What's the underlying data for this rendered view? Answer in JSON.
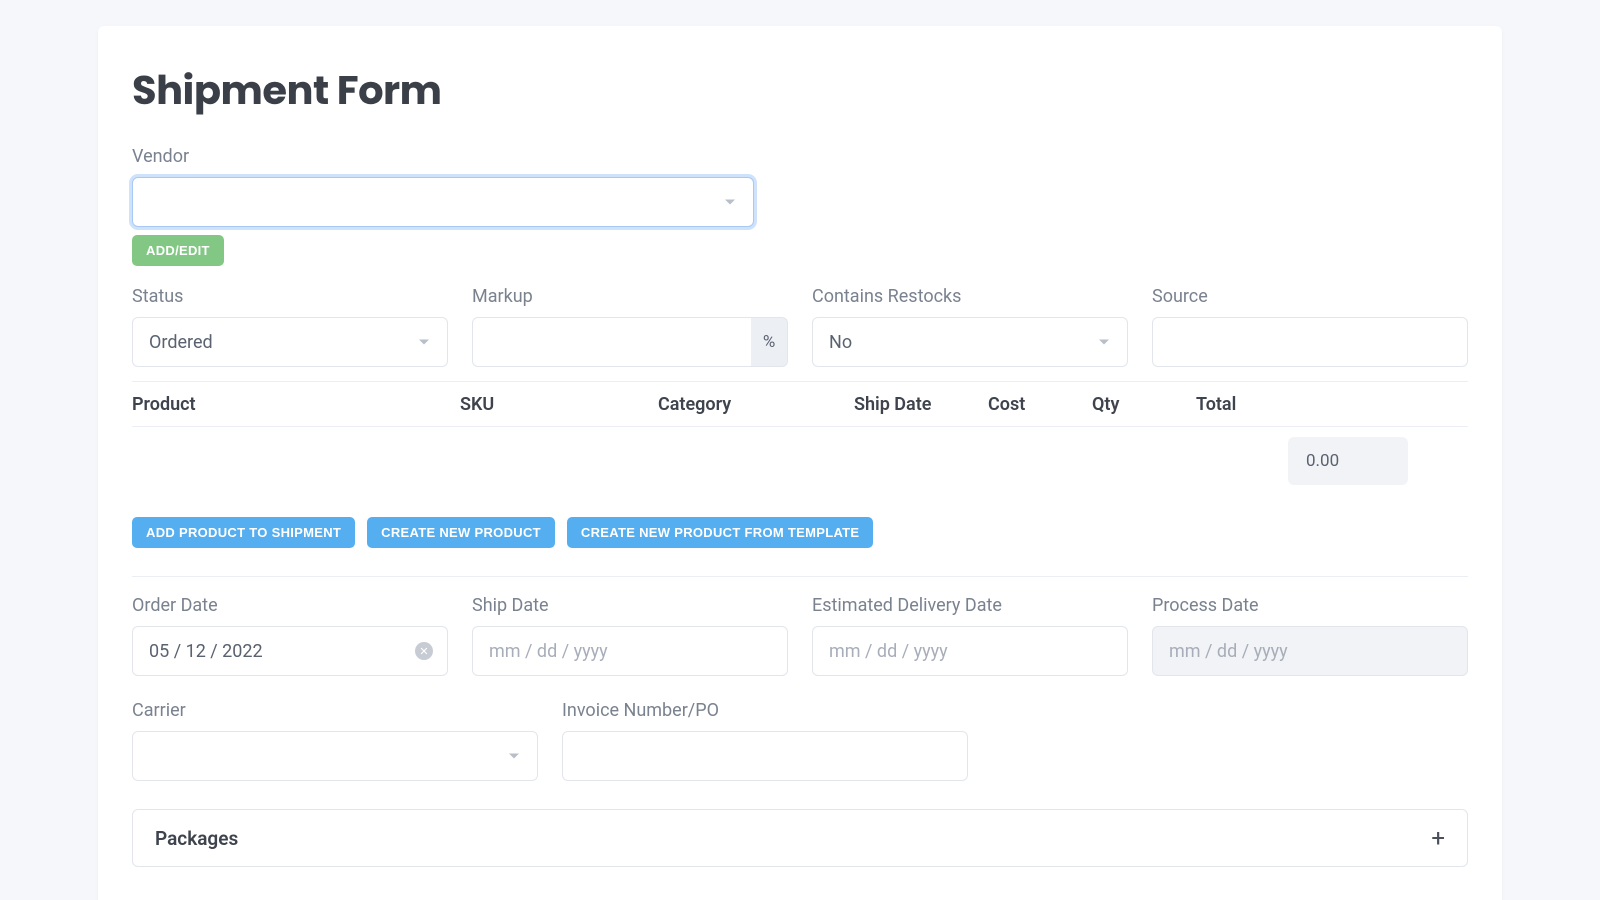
{
  "title": "Shipment Form",
  "vendor": {
    "label": "Vendor",
    "value": "",
    "add_edit_label": "Add/Edit"
  },
  "row1": {
    "status": {
      "label": "Status",
      "value": "Ordered"
    },
    "markup": {
      "label": "Markup",
      "suffix": "%",
      "value": ""
    },
    "restocks": {
      "label": "Contains Restocks",
      "value": "No"
    },
    "source": {
      "label": "Source",
      "value": ""
    }
  },
  "table": {
    "headers": {
      "product": "Product",
      "sku": "SKU",
      "category": "Category",
      "ship_date": "Ship Date",
      "cost": "Cost",
      "qty": "Qty",
      "total": "Total"
    },
    "total_value": "0.00"
  },
  "buttons": {
    "add_product": "Add Product To Shipment",
    "create_product": "Create New Product",
    "create_template": "Create New Product From Template"
  },
  "dates": {
    "order": {
      "label": "Order Date",
      "value": "05 / 12 / 2022"
    },
    "ship": {
      "label": "Ship Date",
      "placeholder": "mm / dd / yyyy"
    },
    "edd": {
      "label": "Estimated Delivery Date",
      "placeholder": "mm / dd / yyyy"
    },
    "process": {
      "label": "Process Date",
      "placeholder": "mm / dd / yyyy"
    }
  },
  "row3": {
    "carrier": {
      "label": "Carrier",
      "value": ""
    },
    "invoice": {
      "label": "Invoice Number/PO",
      "value": ""
    }
  },
  "packages": {
    "label": "Packages"
  }
}
